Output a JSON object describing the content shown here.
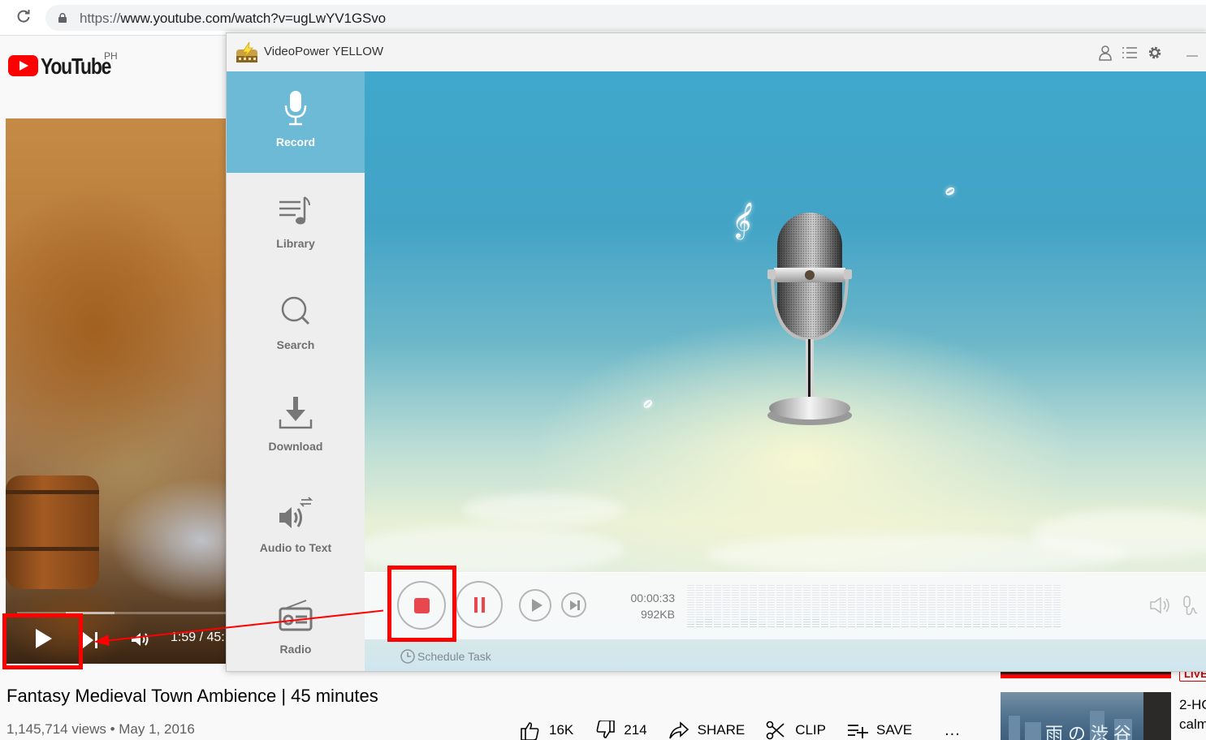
{
  "browser": {
    "url_scheme": "https://",
    "url_rest": "www.youtube.com/watch?v=ugLwYV1GSvo",
    "icons": [
      "reload-icon",
      "lock-icon"
    ]
  },
  "youtube": {
    "logo_text": "YouTube",
    "country_code": "PH",
    "player": {
      "time": "1:59 / 45:",
      "icons": [
        "play-icon",
        "next-icon",
        "volume-icon"
      ]
    },
    "video_title": "Fantasy Medieval Town Ambience | 45 minutes",
    "video_meta": "1,145,714 views • May 1, 2016",
    "actions": [
      {
        "icon": "thumbs-up-icon",
        "label": "16K"
      },
      {
        "icon": "thumbs-down-icon",
        "label": "214"
      },
      {
        "icon": "share-icon",
        "label": "SHARE"
      },
      {
        "icon": "scissors-icon",
        "label": "CLIP"
      },
      {
        "icon": "playlist-add-icon",
        "label": "SAVE"
      }
    ],
    "more_label": "...",
    "recommendations": [
      {
        "badge": "LIVE"
      },
      {
        "title_line1": "2-HO",
        "title_line2": "calm",
        "thumb_text": "雨の渋谷"
      }
    ]
  },
  "videopower": {
    "title": "VideoPower YELLOW",
    "titlebar_icons": [
      "user-icon",
      "menu-list-icon",
      "gear-icon",
      "minimize-icon"
    ],
    "sidebar": [
      {
        "label": "Record",
        "icon": "microphone-icon",
        "active": true
      },
      {
        "label": "Library",
        "icon": "music-library-icon",
        "active": false
      },
      {
        "label": "Search",
        "icon": "search-icon",
        "active": false
      },
      {
        "label": "Download",
        "icon": "download-icon",
        "active": false
      },
      {
        "label": "Audio to Text",
        "icon": "audio-to-text-icon",
        "active": false
      },
      {
        "label": "Radio",
        "icon": "radio-icon",
        "active": false
      }
    ],
    "recorder": {
      "elapsed": "00:00:33",
      "size": "992KB",
      "schedule_label": "Schedule Task",
      "meter_levels": [
        0.12,
        0.18,
        0.2,
        0.1,
        0.1,
        0.08,
        0.22,
        0.22,
        0.1,
        0.06,
        0.14,
        0.1,
        0.1,
        0.22,
        0.24,
        0.08,
        0.04,
        0.05,
        0.05,
        0.1,
        0.1,
        0.14,
        0.08,
        0.04,
        0.04,
        0.04,
        0.04,
        0.08,
        0.08,
        0.04,
        0.08,
        0.08,
        0.1,
        0.08,
        0.08,
        0.08,
        0.05,
        0.04,
        0.04,
        0.04,
        0.04,
        0.04
      ]
    },
    "colors": {
      "accent": "#6cbad6",
      "record_red": "#e8474d",
      "annotation_red": "#ff0000"
    }
  }
}
